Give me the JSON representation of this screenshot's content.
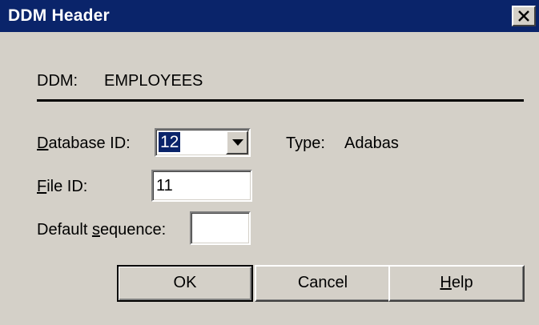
{
  "window": {
    "title": "DDM Header",
    "close_glyph": "×"
  },
  "ddm": {
    "label": "DDM:",
    "name": "EMPLOYEES"
  },
  "form": {
    "database_id_label_mnemonic": "D",
    "database_id_label_rest": "atabase ID:",
    "database_id_value": "12",
    "type_label": "Type:",
    "type_value": "Adabas",
    "file_id_label_mnemonic": "F",
    "file_id_label_rest": "ile ID:",
    "file_id_value": "11",
    "default_sequence_label_pre": "Default ",
    "default_sequence_label_mnemonic": "s",
    "default_sequence_label_rest": "equence:",
    "default_sequence_value": ""
  },
  "buttons": {
    "ok_label": "OK",
    "cancel_label": "Cancel",
    "help_label_mnemonic": "H",
    "help_label_rest": "elp"
  },
  "colors": {
    "titlebar": "#0a246a",
    "face": "#d4d0c8",
    "selection": "#0a246a"
  }
}
